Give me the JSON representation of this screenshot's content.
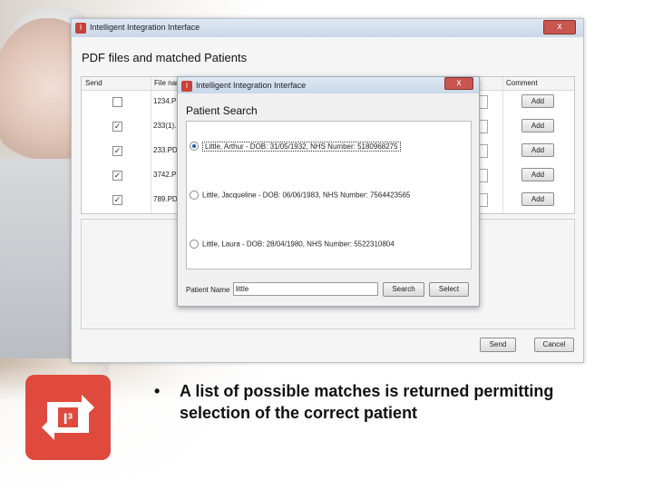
{
  "main_window": {
    "title": "Intelligent Integration Interface",
    "close": "x",
    "heading": "PDF files and matched Patients",
    "columns": [
      "Send",
      "File name",
      "Comment"
    ],
    "rows": [
      {
        "checked": false,
        "file": "1234.PD"
      },
      {
        "checked": true,
        "file": "233(1).P"
      },
      {
        "checked": true,
        "file": "233.PDF"
      },
      {
        "checked": true,
        "file": "3742.PD"
      },
      {
        "checked": true,
        "file": "789.PDF"
      }
    ],
    "add_label": "Add",
    "send_label": "Send",
    "cancel_label": "Cancel"
  },
  "dialog": {
    "title": "Intelligent Integration Interface",
    "close": "x",
    "heading": "Patient Search",
    "options": [
      {
        "label": "Little, Arthur - DOB: 31/05/1932, NHS Number: 5180968275",
        "selected": true
      },
      {
        "label": "Little, Jacqueline - DOB: 06/06/1983, NHS Number: 7564423565",
        "selected": false
      },
      {
        "label": "Little, Laura - DOB: 28/04/1980, NHS Number: 5522310804",
        "selected": false
      }
    ],
    "patient_name_label": "Patient Name",
    "patient_name_value": "little",
    "search_label": "Search",
    "select_label": "Select"
  },
  "logo": {
    "text": "I³",
    "color": "#e04a3e"
  },
  "slide": {
    "bullet": "•",
    "text": "A list of possible matches is returned permitting selection of the correct patient"
  }
}
